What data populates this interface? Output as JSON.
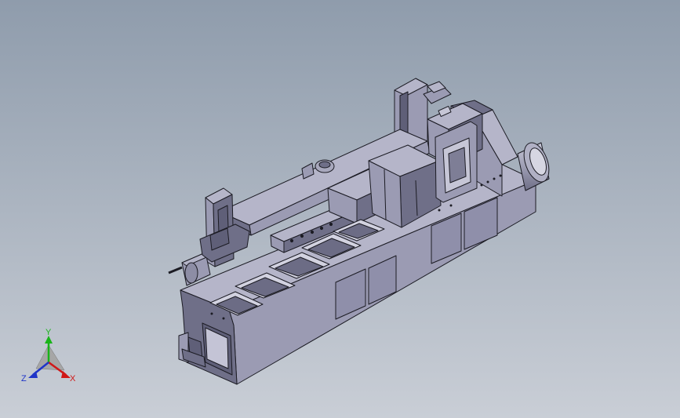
{
  "viewport": {
    "background_top": "#8f9cac",
    "background_bottom": "#c9ced6",
    "model_fill": "#9b9bb3",
    "model_top": "#b5b5c9",
    "model_dark": "#6f6f88",
    "edge": "#1c1c24"
  },
  "triad": {
    "y_label": "Y",
    "x_label": "X",
    "z_label": "Z",
    "y_color": "#19b419",
    "x_color": "#d01818",
    "z_color": "#1f35c8"
  },
  "icons": {
    "triad": "view-orientation-triad-icon",
    "model": "cad-assembly-model"
  }
}
